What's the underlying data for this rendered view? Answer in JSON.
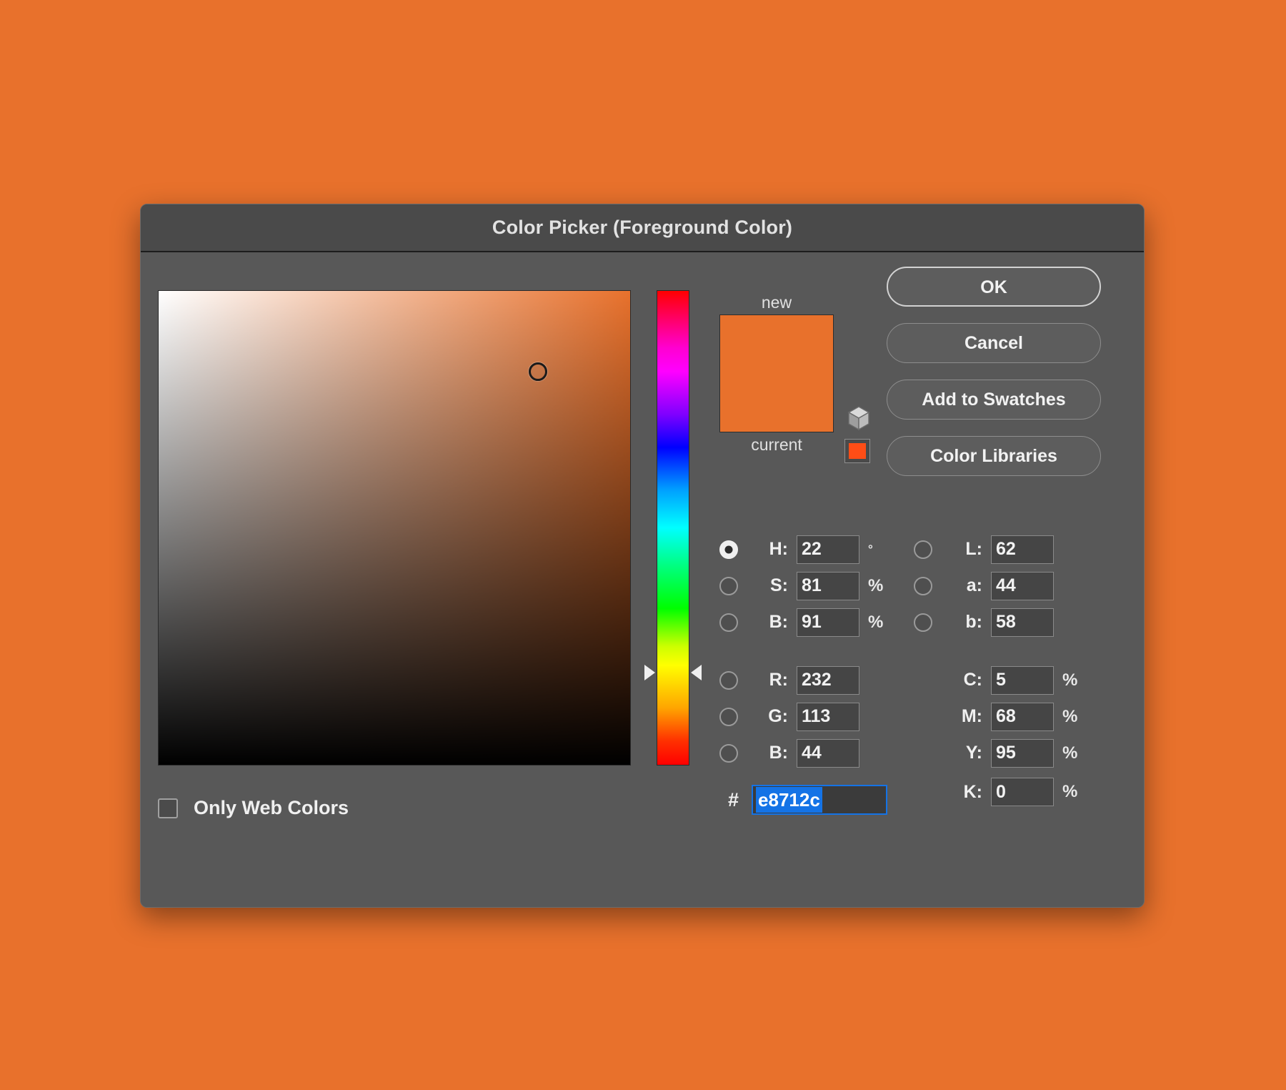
{
  "app": {
    "background_color": "#e8712c"
  },
  "dialog": {
    "title": "Color Picker (Foreground Color)"
  },
  "preview": {
    "new_label": "new",
    "current_label": "current",
    "new_color": "#e8712c",
    "current_color": "#e8712c",
    "websafe_color": "#ff4d16",
    "cube_icon": "cube-icon",
    "websafe_icon": "websafe-swatch-icon"
  },
  "buttons": {
    "ok": "OK",
    "cancel": "Cancel",
    "add_to_swatches": "Add to Swatches",
    "color_libraries": "Color Libraries"
  },
  "fields": {
    "hsb": [
      {
        "key": "H",
        "label": "H:",
        "value": "22",
        "unit": "°",
        "selected": true
      },
      {
        "key": "S",
        "label": "S:",
        "value": "81",
        "unit": "%",
        "selected": false
      },
      {
        "key": "B",
        "label": "B:",
        "value": "91",
        "unit": "%",
        "selected": false
      }
    ],
    "lab": [
      {
        "key": "L",
        "label": "L:",
        "value": "62",
        "unit": "",
        "selected": false
      },
      {
        "key": "a",
        "label": "a:",
        "value": "44",
        "unit": "",
        "selected": false
      },
      {
        "key": "b",
        "label": "b:",
        "value": "58",
        "unit": "",
        "selected": false
      }
    ],
    "rgb": [
      {
        "key": "R",
        "label": "R:",
        "value": "232",
        "unit": "",
        "selected": false
      },
      {
        "key": "G",
        "label": "G:",
        "value": "113",
        "unit": "",
        "selected": false
      },
      {
        "key": "B",
        "label": "B:",
        "value": "44",
        "unit": "",
        "selected": false
      }
    ],
    "cmyk": [
      {
        "key": "C",
        "label": "C:",
        "value": "5",
        "unit": "%"
      },
      {
        "key": "M",
        "label": "M:",
        "value": "68",
        "unit": "%"
      },
      {
        "key": "Y",
        "label": "Y:",
        "value": "95",
        "unit": "%"
      },
      {
        "key": "K",
        "label": "K:",
        "value": "0",
        "unit": "%"
      }
    ],
    "hex": {
      "hash": "#",
      "value": "e8712c",
      "selected": true,
      "selection_color": "#1473e6"
    }
  },
  "options": {
    "only_web_colors_label": "Only Web Colors",
    "only_web_colors_checked": false
  },
  "color_field": {
    "cursor_x_pct": 80.5,
    "cursor_y_pct": 17.0,
    "hue_marker_y_pct": 80.5,
    "base_hue_color": "#e8712c"
  }
}
